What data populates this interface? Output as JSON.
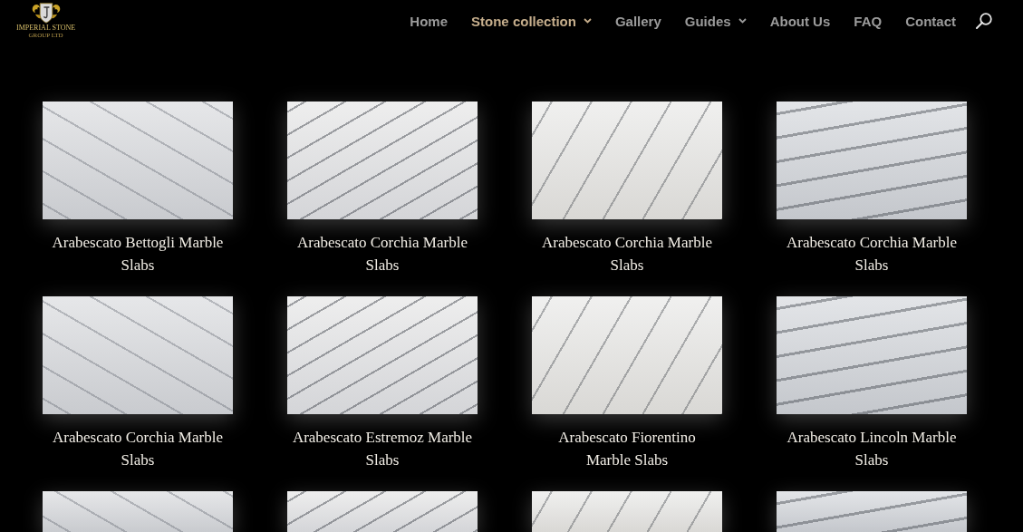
{
  "header": {
    "logo": {
      "name": "IMPERIAL STONE",
      "tagline": "GROUP LTD"
    },
    "nav": [
      {
        "label": "Home",
        "selected": false,
        "dropdown": false
      },
      {
        "label": "Stone collection",
        "selected": true,
        "dropdown": true
      },
      {
        "label": "Gallery",
        "selected": false,
        "dropdown": false
      },
      {
        "label": "Guides",
        "selected": false,
        "dropdown": true
      },
      {
        "label": "About Us",
        "selected": false,
        "dropdown": false
      },
      {
        "label": "FAQ",
        "selected": false,
        "dropdown": false
      },
      {
        "label": "Contact",
        "selected": false,
        "dropdown": false
      }
    ]
  },
  "products": [
    {
      "kind": "card",
      "title": "Arabescato Bettogli Marble Slabs"
    },
    {
      "kind": "card",
      "title": "Arabescato Corchia Marble Slabs"
    },
    {
      "kind": "card",
      "title": "Arabescato Corchia Marble Slabs"
    },
    {
      "kind": "card",
      "title": "Arabescato Corchia Marble Slabs"
    },
    {
      "kind": "card",
      "title": "Arabescato Corchia Marble Slabs"
    },
    {
      "kind": "card",
      "title": "Arabescato Estremoz Marble Slabs"
    },
    {
      "kind": "card",
      "title": "Arabescato Fiorentino Marble Slabs"
    },
    {
      "kind": "card",
      "title": "Arabescato Lincoln Marble Slabs"
    },
    {
      "kind": "photo"
    },
    {
      "kind": "photo"
    },
    {
      "kind": "photo"
    },
    {
      "kind": "photo"
    }
  ]
}
